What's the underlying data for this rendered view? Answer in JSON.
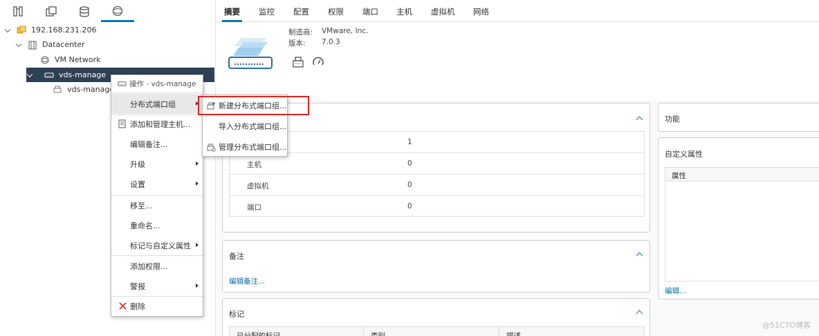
{
  "navigator": {
    "tabs": [
      "hosts-clusters",
      "vms-templates",
      "storage",
      "networking"
    ],
    "tree": [
      {
        "label": "192.168.231.206",
        "icon": "vcenter-icon",
        "level": 0,
        "expanded": true
      },
      {
        "label": "Datacenter",
        "icon": "datacenter-icon",
        "level": 1,
        "expanded": true
      },
      {
        "label": "VM Network",
        "icon": "network-icon",
        "level": 2
      },
      {
        "label": "vds-manage",
        "icon": "distributed-switch-icon",
        "level": 2,
        "expanded": true,
        "selected": true
      },
      {
        "label": "vds-manage",
        "icon": "portgroup-icon",
        "level": 3
      }
    ]
  },
  "tabs": [
    "摘要",
    "监控",
    "配置",
    "权限",
    "端口",
    "主机",
    "虚拟机",
    "网络"
  ],
  "summary": {
    "vendor_label": "制造商:",
    "vendor_value": "VMware, Inc.",
    "version_label": "版本:",
    "version_value": "7.0.3"
  },
  "details_card": {
    "rows": [
      {
        "label": "",
        "value": "1"
      },
      {
        "label": "主机",
        "value": "0"
      },
      {
        "label": "虚拟机",
        "value": "0"
      },
      {
        "label": "端口",
        "value": "0"
      }
    ]
  },
  "notes_card": {
    "title": "备注",
    "link": "编辑备注..."
  },
  "tags_card": {
    "title": "标记",
    "columns": [
      "已分配的标记",
      "类别",
      "描述"
    ]
  },
  "capabilities_card": {
    "title": "功能"
  },
  "custom_attrs_card": {
    "title": "自定义属性",
    "column": "属性",
    "link": "编辑..."
  },
  "context_menu": {
    "header": "操作 - vds-manage",
    "items": [
      {
        "label": "分布式端口组",
        "submenu": true,
        "hover": true
      },
      {
        "label": "添加和管理主机...",
        "icon": "add-host-icon"
      },
      {
        "label": "编辑备注..."
      },
      {
        "label": "升级",
        "submenu": true
      },
      {
        "label": "设置",
        "submenu": true
      },
      {
        "label": "移至..."
      },
      {
        "label": "重命名..."
      },
      {
        "label": "标记与自定义属性",
        "submenu": true
      },
      {
        "label": "添加权限..."
      },
      {
        "label": "警报",
        "submenu": true
      },
      {
        "label": "删除",
        "icon": "delete-icon"
      }
    ]
  },
  "submenu": {
    "items": [
      {
        "label": "新建分布式端口组...",
        "icon": "new-portgroup-icon"
      },
      {
        "label": "导入分布式端口组..."
      },
      {
        "label": "管理分布式端口组...",
        "icon": "manage-portgroup-icon"
      }
    ]
  },
  "colors": {
    "accent": "#0079b8",
    "selected_bg": "#2e4053",
    "highlight": "#e0231c"
  },
  "watermark": "@51CTO博客"
}
